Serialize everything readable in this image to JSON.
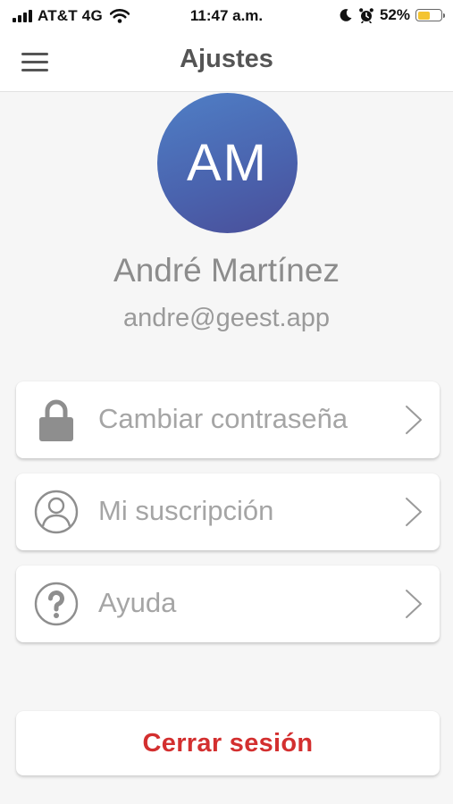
{
  "status_bar": {
    "carrier": "AT&T 4G",
    "time": "11:47 a.m.",
    "battery_percent": "52%",
    "battery_level": 0.52,
    "battery_color": "#f4c430",
    "icons": [
      "signal-icon",
      "wifi-icon",
      "moon-icon",
      "alarm-icon",
      "battery-icon"
    ]
  },
  "header": {
    "title": "Ajustes",
    "menu_icon": "hamburger-menu-icon"
  },
  "profile": {
    "initials": "AM",
    "name": "André Martínez",
    "email": "andre@geest.app",
    "avatar_color": "#4a62ad"
  },
  "menu": {
    "items": [
      {
        "label": "Cambiar contraseña",
        "icon": "lock-icon"
      },
      {
        "label": "Mi suscripción",
        "icon": "user-circle-icon"
      },
      {
        "label": "Ayuda",
        "icon": "help-circle-icon"
      }
    ],
    "chevron_icon": "chevron-right-icon"
  },
  "logout": {
    "label": "Cerrar sesión",
    "color": "#d32f2f"
  }
}
